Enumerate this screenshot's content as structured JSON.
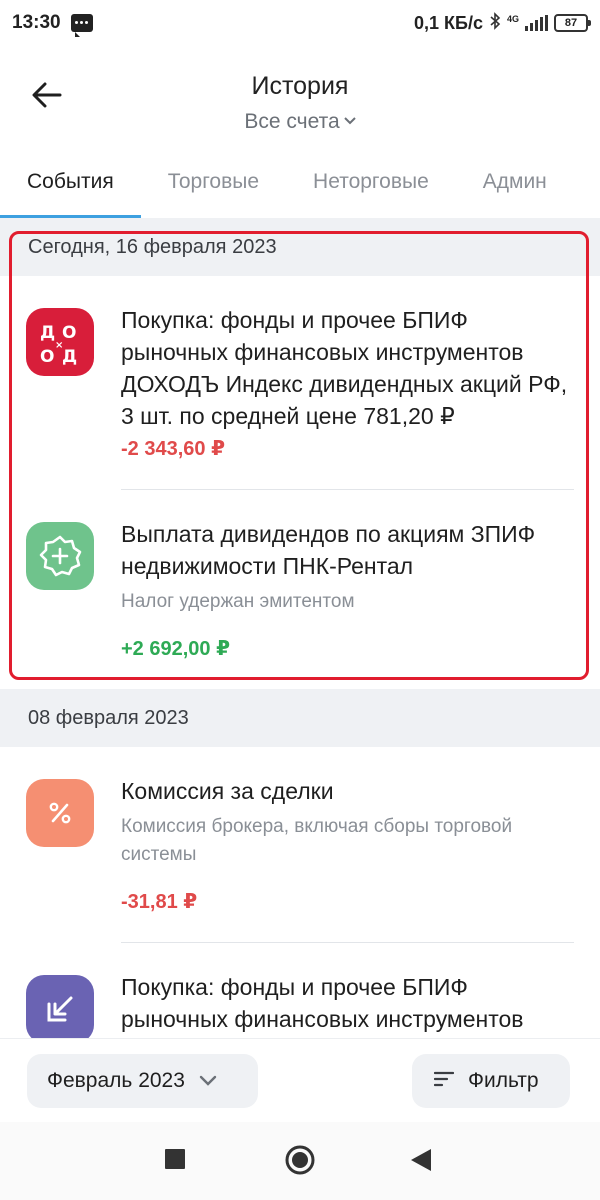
{
  "status_bar": {
    "time": "13:30",
    "speed": "0,1 КБ/с",
    "network": "4G",
    "battery": "87"
  },
  "header": {
    "title": "История",
    "account_selector": "Все счета"
  },
  "tabs": [
    {
      "label": "События",
      "active": true
    },
    {
      "label": "Торговые",
      "active": false
    },
    {
      "label": "Неторговые",
      "active": false
    },
    {
      "label": "Админ",
      "active": false
    }
  ],
  "groups": [
    {
      "date": "Сегодня, 16 февраля 2023",
      "items": [
        {
          "icon": "dohod-logo-icon",
          "icon_text": "ДОХОДЪ",
          "title": "Покупка: фонды и прочее БПИФ рыночных финансовых инструментов ДОХОДЪ Индекс дивидендных акций РФ, 3 шт. по средней цене 781,20 ₽",
          "amount": "-2 343,60 ₽"
        },
        {
          "icon": "dividend-badge-icon",
          "title": "Выплата дивидендов по акциям ЗПИФ недвижимости ПНК-Рентал",
          "subtitle": "Налог удержан эмитентом",
          "amount": "+2 692,00 ₽"
        }
      ]
    },
    {
      "date": "08 февраля 2023",
      "items": [
        {
          "icon": "percent-icon",
          "title": "Комиссия за сделки",
          "subtitle": "Комиссия брокера, включая сборы торговой системы",
          "amount": "-31,81 ₽"
        },
        {
          "icon": "buy-arrow-icon",
          "title": "Покупка: фонды и прочее БПИФ рыночных финансовых инструментов"
        }
      ]
    }
  ],
  "bottom_bar": {
    "month_label": "Февраль 2023",
    "filter_label": "Фильтр"
  },
  "colors": {
    "negative": "#e04a4a",
    "positive": "#2eaa55",
    "tab_indicator": "#3da0e0",
    "dohod_red": "#d81e3a",
    "dividend_green": "#6fc38c",
    "percent_orange": "#f58f72",
    "buy_purple": "#6a63b3",
    "highlight_border": "#e11d2e"
  }
}
